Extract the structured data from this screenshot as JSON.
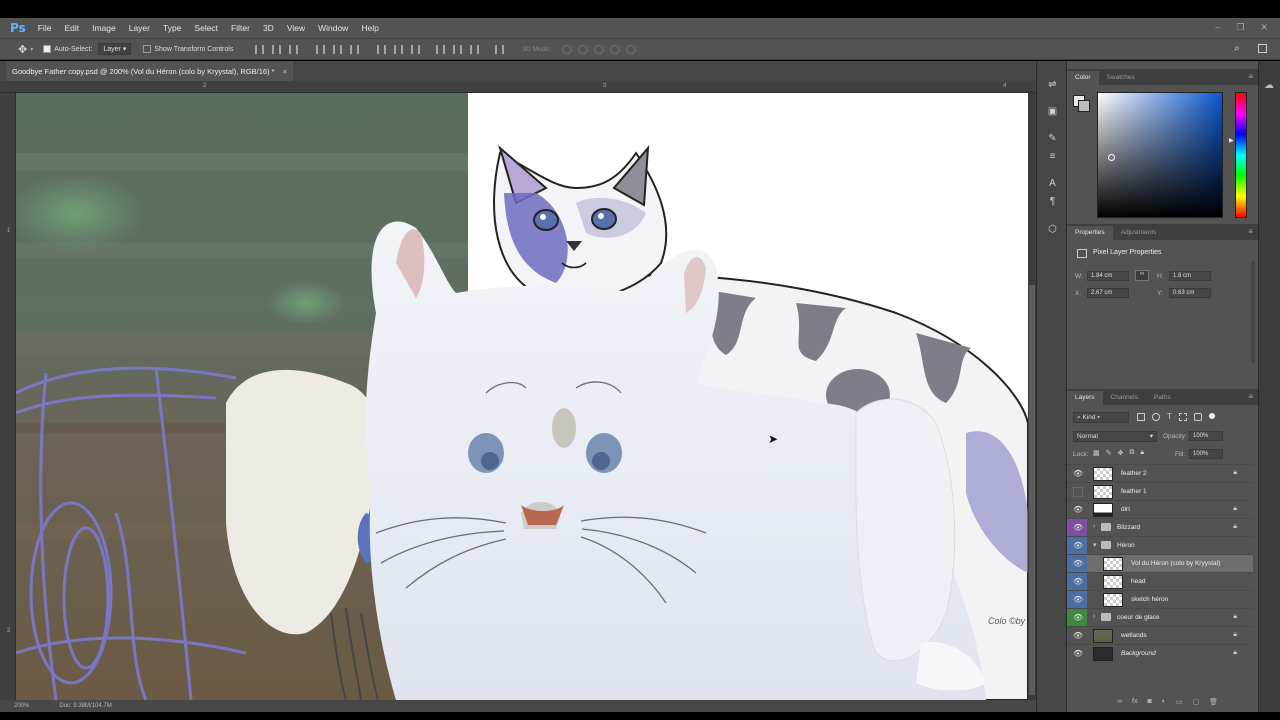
{
  "app": {
    "logo": "Ps"
  },
  "menu": [
    "File",
    "Edit",
    "Image",
    "Layer",
    "Type",
    "Select",
    "Filter",
    "3D",
    "View",
    "Window",
    "Help"
  ],
  "window_controls": [
    "–",
    "❐",
    "✕"
  ],
  "options": {
    "auto_select_label": "Auto-Select:",
    "auto_select_value": "Layer",
    "show_transform_label": "Show Transform Controls",
    "mode_3d_label": "3D Mode:"
  },
  "document": {
    "tab_title": "Goodbye Father copy.psd @ 200% (Vol du Héron (colo by Kryystal), RGB/16) *",
    "close": "×"
  },
  "rulers": {
    "top": [
      "2",
      "3",
      "4"
    ],
    "left": [
      "1",
      "2"
    ]
  },
  "status": {
    "zoom": "200%",
    "doc": "Doc: 9.38M/104.7M"
  },
  "canvas_text": {
    "watermark": "Colo ©by"
  },
  "color_panel": {
    "tabs": [
      "Color",
      "Swatches"
    ],
    "accent_hex": "#0b57d0"
  },
  "properties_panel": {
    "tabs": [
      "Properties",
      "Adjustments"
    ],
    "title": "Pixel Layer Properties",
    "w_label": "W:",
    "w_value": "1.84 cm",
    "h_label": "H:",
    "h_value": "1.8 cm",
    "x_label": "X:",
    "x_value": "2.67 cm",
    "y_label": "Y:",
    "y_value": "0.63 cm"
  },
  "layers_panel": {
    "tabs": [
      "Layers",
      "Channels",
      "Paths"
    ],
    "filter_label": "Kind",
    "blend_mode": "Normal",
    "opacity_label": "Opacity:",
    "opacity_value": "100%",
    "lock_label": "Lock:",
    "fill_label": "Fill:",
    "fill_value": "100%",
    "layers": [
      {
        "name": "feather 2",
        "visible": true,
        "locked": true,
        "color": "",
        "type": "layer",
        "indent": 0
      },
      {
        "name": "feather 1",
        "visible": false,
        "locked": false,
        "color": "",
        "type": "layer",
        "indent": 0
      },
      {
        "name": "dirt",
        "visible": true,
        "locked": true,
        "color": "",
        "type": "layer",
        "indent": 0
      },
      {
        "name": "Blizzard",
        "visible": true,
        "locked": true,
        "color": "#7d4fa0",
        "type": "group",
        "indent": 0
      },
      {
        "name": "Héron",
        "visible": true,
        "locked": false,
        "color": "#4a6fa5",
        "type": "group-open",
        "indent": 0
      },
      {
        "name": "Vol du Héron (colo by Kryystal)",
        "visible": true,
        "locked": false,
        "color": "#4a6fa5",
        "type": "layer",
        "indent": 1,
        "selected": true
      },
      {
        "name": "head",
        "visible": true,
        "locked": false,
        "color": "#4a6fa5",
        "type": "layer",
        "indent": 1
      },
      {
        "name": "sketch héron",
        "visible": true,
        "locked": false,
        "color": "#4a6fa5",
        "type": "layer",
        "indent": 1
      },
      {
        "name": "coeur de glace",
        "visible": true,
        "locked": true,
        "color": "#3d8a3d",
        "type": "group",
        "indent": 0
      },
      {
        "name": "wetlands",
        "visible": true,
        "locked": true,
        "color": "",
        "type": "layer",
        "indent": 0
      },
      {
        "name": "Background",
        "visible": true,
        "locked": true,
        "color": "",
        "type": "layer",
        "indent": 0,
        "italic": true
      }
    ]
  }
}
